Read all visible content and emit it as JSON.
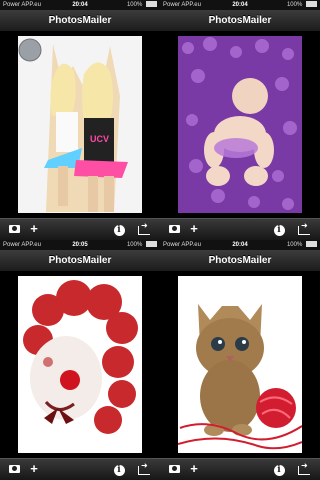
{
  "screens": [
    {
      "status": {
        "carrier": "Power APP.eu",
        "time": "20:04",
        "battery": "100%"
      },
      "title": "PhotosMailer",
      "photo": "two blonde women dancing, neon outfits, disco ball"
    },
    {
      "status": {
        "carrier": "Power APP.eu",
        "time": "20:04",
        "battery": "100%"
      },
      "title": "PhotosMailer",
      "photo": "baby lying on purple flowers"
    },
    {
      "status": {
        "carrier": "Power APP.eu",
        "time": "20:05",
        "battery": "100%"
      },
      "title": "PhotosMailer",
      "photo": "clown with red curly wig and red nose"
    },
    {
      "status": {
        "carrier": "Power APP.eu",
        "time": "20:04",
        "battery": "100%"
      },
      "title": "PhotosMailer",
      "photo": "tabby kitten with red yarn ball"
    }
  ],
  "icons": {
    "camera": "camera-icon",
    "add": "plus-icon",
    "info": "info-icon",
    "share": "share-icon"
  },
  "colors": {
    "background": "#000000",
    "bar_top": "#3c3c3c",
    "bar_bottom": "#1c1c1c"
  }
}
